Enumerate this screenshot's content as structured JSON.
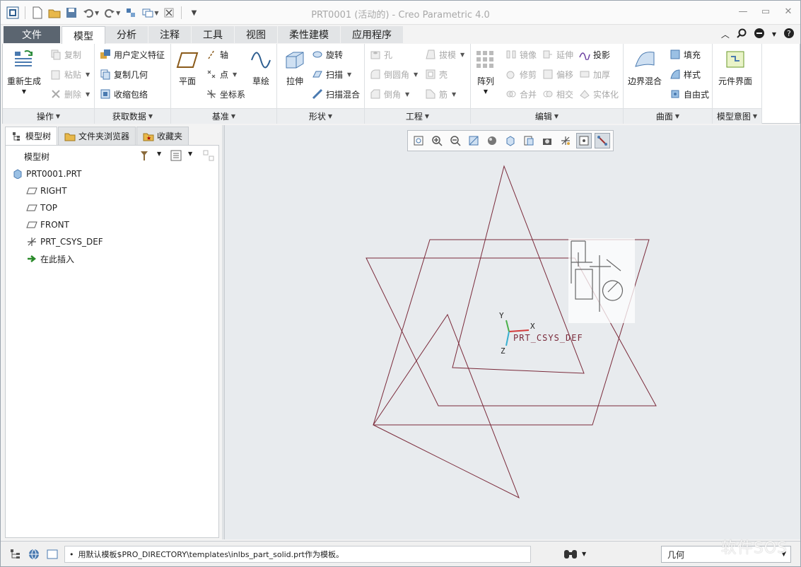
{
  "window": {
    "title": "PRT0001 (活动的) - Creo Parametric 4.0"
  },
  "tabs": {
    "file": "文件",
    "items": [
      "模型",
      "分析",
      "注释",
      "工具",
      "视图",
      "柔性建模",
      "应用程序"
    ],
    "active": "模型"
  },
  "ribbon": {
    "operations": {
      "label": "操作",
      "regenerate": "重新生成",
      "copy": "复制",
      "paste": "粘贴",
      "delete": "删除"
    },
    "getdata": {
      "label": "获取数据",
      "udf": "用户定义特征",
      "copygeom": "复制几何",
      "shrinkwrap": "收缩包络"
    },
    "datum": {
      "label": "基准",
      "plane": "平面",
      "axis": "轴",
      "point": "点",
      "csys": "坐标系",
      "sketch": "草绘"
    },
    "shapes": {
      "label": "形状",
      "extrude": "拉伸",
      "revolve": "旋转",
      "sweep": "扫描",
      "sweptblend": "扫描混合"
    },
    "engineering": {
      "label": "工程",
      "hole": "孔",
      "round": "倒圆角",
      "chamfer": "倒角",
      "draft": "拔模",
      "shell": "壳",
      "rib": "筋"
    },
    "editing": {
      "label": "编辑",
      "pattern": "阵列",
      "mirror": "镜像",
      "trim": "修剪",
      "merge": "合并",
      "extend": "延伸",
      "offset": "偏移",
      "intersect": "相交",
      "project": "投影",
      "thicken": "加厚",
      "solidify": "实体化"
    },
    "surfaces": {
      "label": "曲面",
      "boundaryblend": "边界混合",
      "fill": "填充",
      "style": "样式",
      "freestyle": "自由式"
    },
    "intent": {
      "label": "模型意图",
      "component": "元件界面"
    }
  },
  "panel": {
    "tabs": [
      "模型树",
      "文件夹浏览器",
      "收藏夹"
    ],
    "header": "模型树",
    "tree": [
      {
        "label": "PRT0001.PRT",
        "icon": "part-icon"
      },
      {
        "label": "RIGHT",
        "icon": "datum-plane-icon"
      },
      {
        "label": "TOP",
        "icon": "datum-plane-icon"
      },
      {
        "label": "FRONT",
        "icon": "datum-plane-icon"
      },
      {
        "label": "PRT_CSYS_DEF",
        "icon": "csys-icon"
      },
      {
        "label": "在此插入",
        "icon": "insert-arrow-icon"
      }
    ]
  },
  "graphics": {
    "csys_label": "PRT_CSYS_DEF",
    "axis_x": "X",
    "axis_y": "Y",
    "axis_z": "Z",
    "datum_color": "#7a2a3a"
  },
  "status": {
    "message": "用默认模板$PRO_DIRECTORY\\templates\\inlbs_part_solid.prt作为模板。",
    "filter": "几何"
  },
  "brand": "软件SOS"
}
